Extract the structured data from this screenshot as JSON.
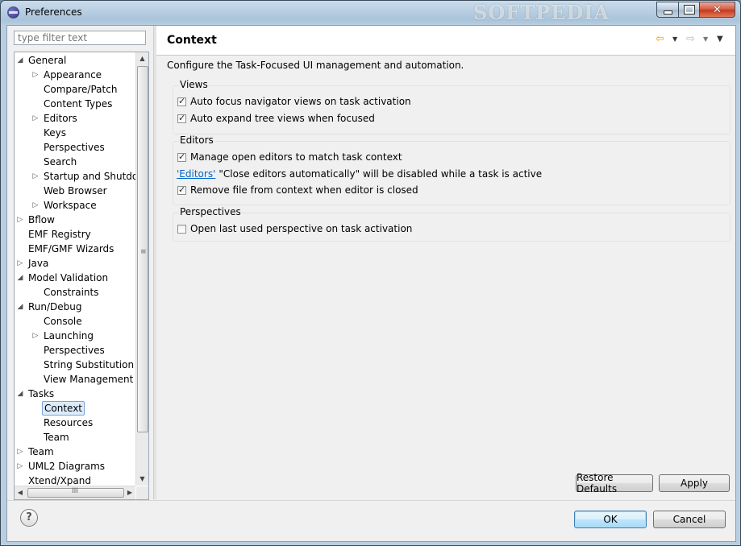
{
  "window": {
    "title": "Preferences",
    "watermark": "SOFTPEDIA",
    "controls": {
      "minimize": "minimize",
      "maximize": "maximize",
      "close": "✕"
    }
  },
  "filter": {
    "placeholder": "type filter text"
  },
  "tree": [
    {
      "label": "General",
      "level": 0,
      "twisty": "expanded"
    },
    {
      "label": "Appearance",
      "level": 1,
      "twisty": "collapsed"
    },
    {
      "label": "Compare/Patch",
      "level": 1,
      "twisty": "none"
    },
    {
      "label": "Content Types",
      "level": 1,
      "twisty": "none"
    },
    {
      "label": "Editors",
      "level": 1,
      "twisty": "collapsed"
    },
    {
      "label": "Keys",
      "level": 1,
      "twisty": "none"
    },
    {
      "label": "Perspectives",
      "level": 1,
      "twisty": "none"
    },
    {
      "label": "Search",
      "level": 1,
      "twisty": "none"
    },
    {
      "label": "Startup and Shutdown",
      "level": 1,
      "twisty": "collapsed"
    },
    {
      "label": "Web Browser",
      "level": 1,
      "twisty": "none"
    },
    {
      "label": "Workspace",
      "level": 1,
      "twisty": "collapsed"
    },
    {
      "label": "Bflow",
      "level": 0,
      "twisty": "collapsed"
    },
    {
      "label": "EMF Registry",
      "level": 0,
      "twisty": "none"
    },
    {
      "label": "EMF/GMF Wizards",
      "level": 0,
      "twisty": "none"
    },
    {
      "label": "Java",
      "level": 0,
      "twisty": "collapsed"
    },
    {
      "label": "Model Validation",
      "level": 0,
      "twisty": "expanded"
    },
    {
      "label": "Constraints",
      "level": 1,
      "twisty": "none"
    },
    {
      "label": "Run/Debug",
      "level": 0,
      "twisty": "expanded"
    },
    {
      "label": "Console",
      "level": 1,
      "twisty": "none"
    },
    {
      "label": "Launching",
      "level": 1,
      "twisty": "collapsed"
    },
    {
      "label": "Perspectives",
      "level": 1,
      "twisty": "none"
    },
    {
      "label": "String Substitution",
      "level": 1,
      "twisty": "none"
    },
    {
      "label": "View Management",
      "level": 1,
      "twisty": "none"
    },
    {
      "label": "Tasks",
      "level": 0,
      "twisty": "expanded"
    },
    {
      "label": "Context",
      "level": 1,
      "twisty": "none",
      "selected": true
    },
    {
      "label": "Resources",
      "level": 1,
      "twisty": "none"
    },
    {
      "label": "Team",
      "level": 1,
      "twisty": "none"
    },
    {
      "label": "Team",
      "level": 0,
      "twisty": "collapsed"
    },
    {
      "label": "UML2 Diagrams",
      "level": 0,
      "twisty": "collapsed"
    },
    {
      "label": "Xtend/Xpand",
      "level": 0,
      "twisty": "none"
    }
  ],
  "page": {
    "title": "Context",
    "description": "Configure the Task-Focused UI management and automation.",
    "groups": [
      {
        "title": "Views",
        "rows": [
          {
            "type": "checkbox",
            "label": "Auto focus navigator views on task activation",
            "checked": true
          },
          {
            "type": "checkbox",
            "label": "Auto expand tree views when focused",
            "checked": true
          }
        ]
      },
      {
        "title": "Editors",
        "rows": [
          {
            "type": "checkbox",
            "label": "Manage open editors to match task context",
            "checked": true
          },
          {
            "type": "link",
            "link": "'Editors'",
            "text": "\"Close editors automatically\" will be disabled while a task is active"
          },
          {
            "type": "checkbox",
            "label": "Remove file from context when editor is closed",
            "checked": true
          }
        ]
      },
      {
        "title": "Perspectives",
        "rows": [
          {
            "type": "checkbox",
            "label": "Open last used perspective on task activation",
            "checked": false
          }
        ]
      }
    ],
    "restore_defaults": "Restore Defaults",
    "apply": "Apply"
  },
  "footer": {
    "help": "?",
    "ok": "OK",
    "cancel": "Cancel"
  },
  "icons": {
    "back": "⇦",
    "forward": "⇨",
    "dropdown": "▼",
    "view_menu": "▼",
    "twisty_expanded": "◢",
    "twisty_collapsed": "▷",
    "scroll_up": "▲",
    "scroll_down": "▼",
    "scroll_left": "◀",
    "scroll_right": "▶",
    "grip_v": "≡",
    "grip_h": "III"
  }
}
